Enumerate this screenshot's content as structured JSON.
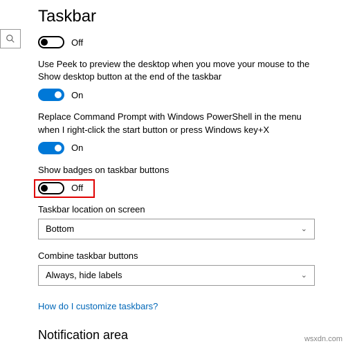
{
  "header": {
    "title": "Taskbar"
  },
  "toggle_states": {
    "on": "On",
    "off": "Off"
  },
  "settings": {
    "top_toggle": {
      "state": "off"
    },
    "peek": {
      "desc": "Use Peek to preview the desktop when you move your mouse to the Show desktop button at the end of the taskbar",
      "state": "on"
    },
    "powershell": {
      "desc": "Replace Command Prompt with Windows PowerShell in the menu when I right-click the start button or press Windows key+X",
      "state": "on"
    },
    "badges": {
      "desc": "Show badges on taskbar buttons",
      "state": "off"
    }
  },
  "taskbar_location": {
    "label": "Taskbar location on screen",
    "value": "Bottom"
  },
  "combine": {
    "label": "Combine taskbar buttons",
    "value": "Always, hide labels"
  },
  "help_link": "How do I customize taskbars?",
  "section2": {
    "title": "Notification area"
  },
  "watermark": "wsxdn.com"
}
